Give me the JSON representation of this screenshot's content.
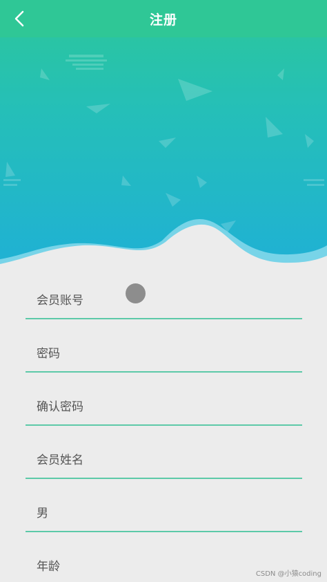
{
  "header": {
    "title": "注册",
    "back_icon": "chevron-left-icon"
  },
  "form": {
    "fields": [
      {
        "placeholder": "会员账号"
      },
      {
        "placeholder": "密码"
      },
      {
        "placeholder": "确认密码"
      },
      {
        "placeholder": "会员姓名"
      },
      {
        "placeholder": "男"
      },
      {
        "placeholder": "年龄"
      }
    ]
  },
  "watermark": "CSDN @小猿coding",
  "colors": {
    "topbar": "#2fc796",
    "gradient_top": "#2cc79a",
    "gradient_bottom": "#1fb0d6",
    "underline": "#5cc9a8",
    "background": "#ececec"
  }
}
